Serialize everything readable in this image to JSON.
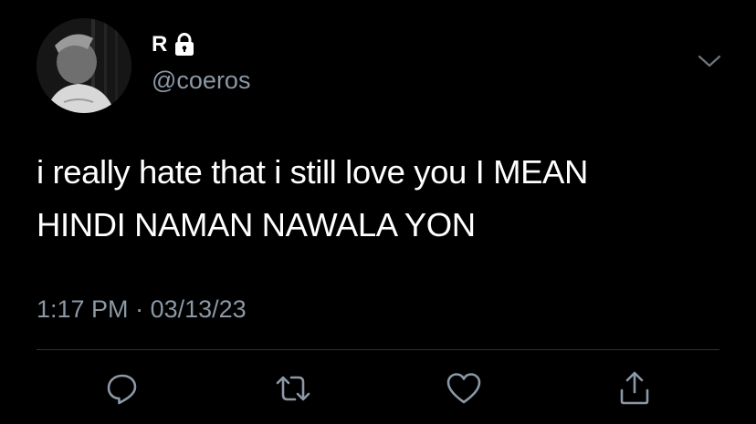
{
  "author": {
    "display_name": "R",
    "handle": "@coeros",
    "protected": true,
    "avatar_icon": "profile-photo"
  },
  "tweet": {
    "text": "i really hate that i still love you I MEAN\nHINDI NAMAN NAWALA YON",
    "time": "1:17 PM",
    "separator": "·",
    "date": "03/13/23"
  },
  "actions": [
    {
      "icon": "reply-icon"
    },
    {
      "icon": "retweet-icon"
    },
    {
      "icon": "like-icon"
    },
    {
      "icon": "share-icon"
    }
  ],
  "colors": {
    "background": "#000000",
    "text": "#ffffff",
    "secondary": "#8b98a5",
    "divider": "#2f3336"
  }
}
